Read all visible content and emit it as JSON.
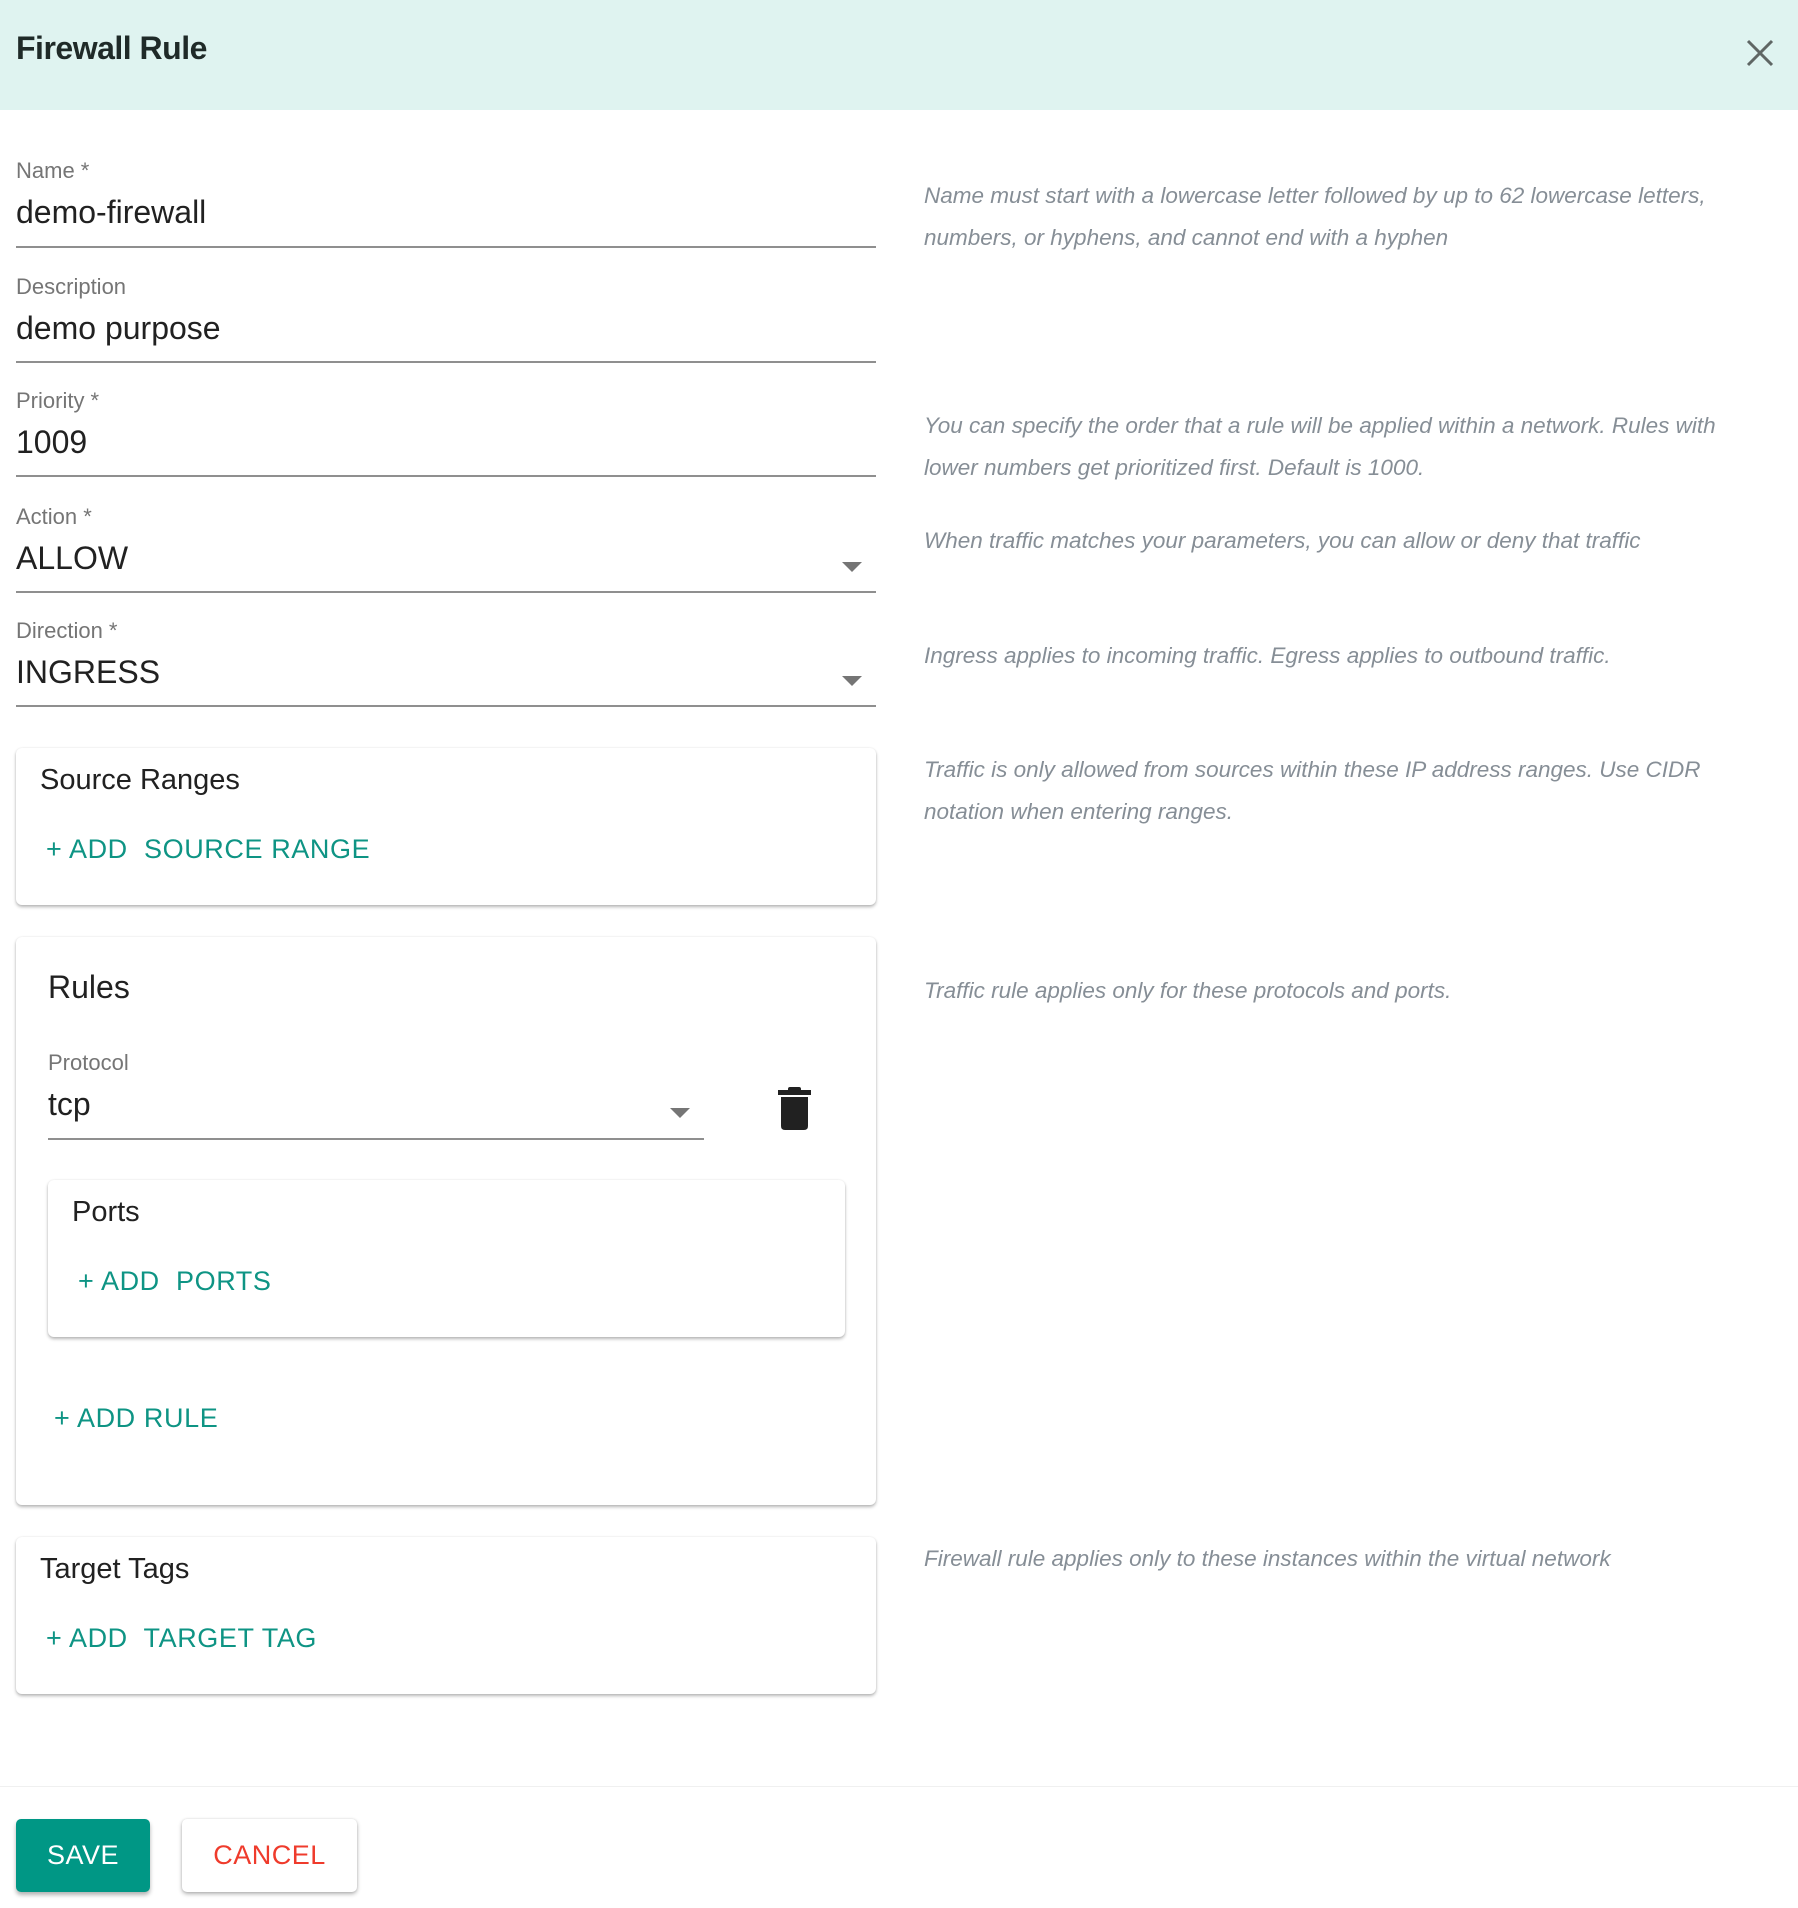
{
  "dialog": {
    "title": "Firewall Rule",
    "close_icon": "close-icon"
  },
  "form": {
    "name": {
      "label": "Name *",
      "value": "demo-firewall",
      "help": "Name must start with a lowercase letter followed by up to 62 lowercase letters, numbers, or hyphens, and cannot end with a hyphen"
    },
    "description": {
      "label": "Description",
      "value": "demo purpose"
    },
    "priority": {
      "label": "Priority *",
      "value": "1009",
      "help": "You can specify the order that a rule will be applied within a network. Rules with lower numbers get prioritized first. Default is 1000."
    },
    "action": {
      "label": "Action *",
      "value": "ALLOW",
      "help": "When traffic matches your parameters, you can allow or deny that traffic"
    },
    "direction": {
      "label": "Direction *",
      "value": "INGRESS",
      "help": "Ingress applies to incoming traffic. Egress applies to outbound traffic."
    }
  },
  "source_ranges": {
    "title": "Source Ranges",
    "add_label": "+ ADD  SOURCE RANGE",
    "help": "Traffic is only allowed from sources within these IP address ranges. Use CIDR notation when entering ranges."
  },
  "rules": {
    "title": "Rules",
    "help": "Traffic rule applies only for these protocols and ports.",
    "items": [
      {
        "protocol_label": "Protocol",
        "protocol_value": "tcp",
        "delete_icon": "trash-icon",
        "ports": {
          "title": "Ports",
          "add_label": "+ ADD  PORTS"
        }
      }
    ],
    "add_rule_label": "+ ADD RULE"
  },
  "target_tags": {
    "title": "Target Tags",
    "add_label": "+ ADD  TARGET TAG",
    "help": "Firewall rule applies only to these instances within the virtual network"
  },
  "footer": {
    "save_label": "SAVE",
    "cancel_label": "CANCEL"
  },
  "colors": {
    "header_bg": "#dff3f0",
    "accent": "#009785",
    "cancel": "#ef3b2c",
    "help_text": "#868e96"
  }
}
